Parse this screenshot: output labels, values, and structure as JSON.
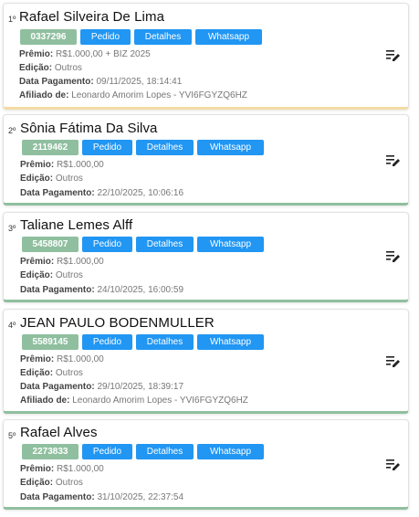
{
  "labels": {
    "pedido": "Pedido",
    "detalhes": "Detalhes",
    "whatsapp": "Whatsapp",
    "premio": "Prêmio:",
    "edicao": "Edição:",
    "data_pagamento": "Data Pagamento:",
    "afiliado": "Afiliado de:"
  },
  "colors": {
    "code_chip": "#8fbf9f",
    "button": "#2196f3",
    "first_border": "#f3dca4",
    "other_border": "#8fbf9f"
  },
  "icons": {
    "edit": "playlist-edit-icon"
  },
  "winners": [
    {
      "rank": "1º",
      "name": "Rafael Silveira De Lima",
      "code": "0337296",
      "premio": "R$1.000,00 + BIZ 2025",
      "edicao": "Outros",
      "data_pagamento": "09/11/2025, 18:14:41",
      "afiliado": "Leonardo Amorim Lopes - YVI6FGYZQ6HZ"
    },
    {
      "rank": "2º",
      "name": "Sônia Fátima Da Silva",
      "code": "2119462",
      "premio": "R$1.000,00",
      "edicao": "Outros",
      "data_pagamento": "22/10/2025, 10:06:16"
    },
    {
      "rank": "3º",
      "name": "Taliane Lemes Alff",
      "code": "5458807",
      "premio": "R$1.000,00",
      "edicao": "Outros",
      "data_pagamento": "24/10/2025, 16:00:59"
    },
    {
      "rank": "4º",
      "name": "JEAN PAULO BODENMULLER",
      "code": "5589145",
      "premio": "R$1.000,00",
      "edicao": "Outros",
      "data_pagamento": "29/10/2025, 18:39:17",
      "afiliado": "Leonardo Amorim Lopes - YVI6FGYZQ6HZ"
    },
    {
      "rank": "5º",
      "name": "Rafael Alves",
      "code": "2273833",
      "premio": "R$1.000,00",
      "edicao": "Outros",
      "data_pagamento": "31/10/2025, 22:37:54"
    }
  ]
}
